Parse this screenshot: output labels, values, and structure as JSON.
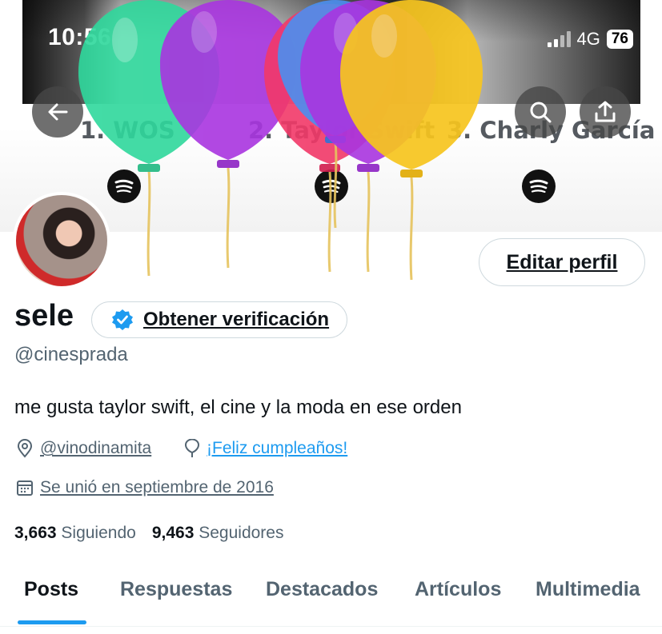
{
  "status_bar": {
    "time": "10:56",
    "network": "4G",
    "battery": "76"
  },
  "banner": {
    "ranks": [
      "1. WOS",
      "2. Taylor Swift",
      "3. Charly García"
    ]
  },
  "profile": {
    "name": "sele",
    "handle": "@cinesprada",
    "bio": "me gusta taylor swift, el cine y la moda en ese orden",
    "location": "@vinodinamita",
    "birthday": "¡Feliz cumpleaños!",
    "joined": "Se unió en septiembre de 2016",
    "following_count": "3,663",
    "following_label": "Siguiendo",
    "followers_count": "9,463",
    "followers_label": "Seguidores"
  },
  "buttons": {
    "edit_profile": "Editar perfil",
    "get_verified": "Obtener verificación"
  },
  "tabs": [
    "Posts",
    "Respuestas",
    "Destacados",
    "Artículos",
    "Multimedia"
  ],
  "colors": {
    "accent": "#1d9bf0",
    "text": "#0f1419",
    "secondary": "#536471"
  },
  "icons": [
    "back-arrow-icon",
    "search-icon",
    "share-icon",
    "spotify-icon",
    "location-pin-icon",
    "balloon-icon",
    "calendar-icon",
    "verified-badge-icon"
  ]
}
